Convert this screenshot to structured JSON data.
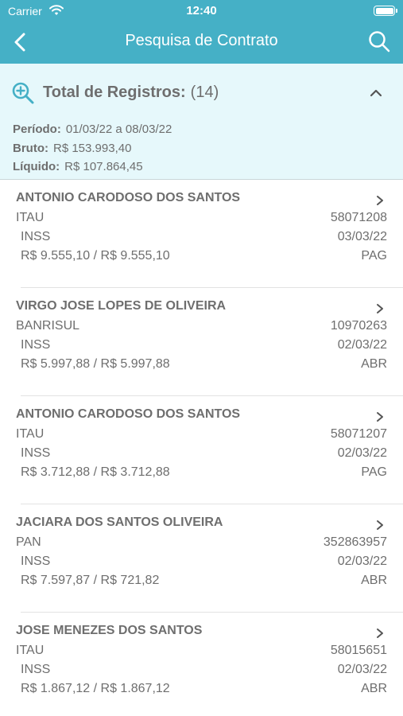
{
  "status_bar": {
    "carrier": "Carrier",
    "time": "12:40"
  },
  "header": {
    "title": "Pesquisa de Contrato"
  },
  "summary": {
    "total_label": "Total de Registros:",
    "total_count": "(14)",
    "periodo_label": "Período:",
    "periodo_value": "01/03/22 a 08/03/22",
    "bruto_label": "Bruto:",
    "bruto_value": "R$ 153.993,40",
    "liquido_label": "Líquido:",
    "liquido_value": "R$ 107.864,45"
  },
  "contracts": [
    {
      "name": "ANTONIO CARODOSO DOS SANTOS",
      "bank": "ITAU",
      "contract": "58071208",
      "org": "INSS",
      "date": "03/03/22",
      "values": "R$ 9.555,10 / R$ 9.555,10",
      "status": "PAG"
    },
    {
      "name": "VIRGO JOSE LOPES DE OLIVEIRA",
      "bank": "BANRISUL",
      "contract": "10970263",
      "org": "INSS",
      "date": "02/03/22",
      "values": "R$ 5.997,88 / R$ 5.997,88",
      "status": "ABR"
    },
    {
      "name": "ANTONIO CARODOSO DOS SANTOS",
      "bank": "ITAU",
      "contract": "58071207",
      "org": "INSS",
      "date": "02/03/22",
      "values": "R$ 3.712,88 / R$ 3.712,88",
      "status": "PAG"
    },
    {
      "name": "JACIARA DOS SANTOS OLIVEIRA",
      "bank": "PAN",
      "contract": "352863957",
      "org": "INSS",
      "date": "02/03/22",
      "values": "R$ 7.597,87 / R$ 721,82",
      "status": "ABR"
    },
    {
      "name": "JOSE MENEZES DOS SANTOS",
      "bank": "ITAU",
      "contract": "58015651",
      "org": "INSS",
      "date": "02/03/22",
      "values": "R$ 1.867,12 / R$ 1.867,12",
      "status": "ABR"
    }
  ],
  "colors": {
    "header": "#45b0c6",
    "summary_bg": "#e6f8fb",
    "text": "#6e6e6e"
  },
  "icons": {
    "back": "chevron-left-icon",
    "search": "search-icon",
    "zoom": "zoom-in-icon",
    "collapse": "chevron-up-icon",
    "row": "chevron-right-icon"
  }
}
